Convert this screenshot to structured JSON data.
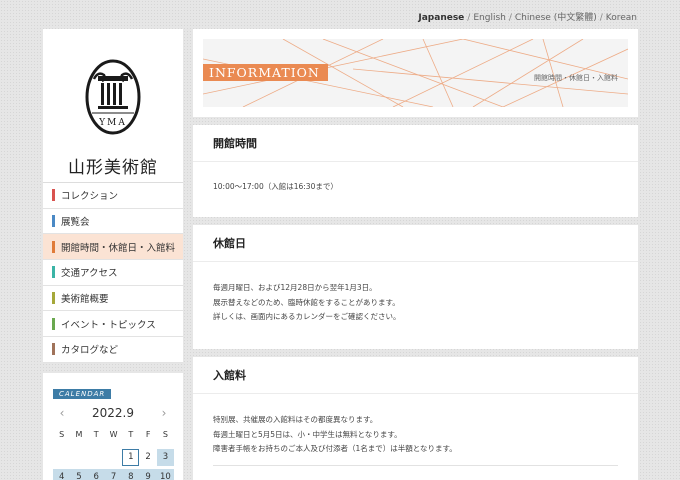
{
  "lang_bar": [
    {
      "label": "Japanese"
    },
    {
      "label": "English"
    },
    {
      "label": "Chinese (中文繁體)"
    },
    {
      "label": "Korean"
    }
  ],
  "logo": {
    "emblem_text": "YMA",
    "name": "山形美術館"
  },
  "nav": [
    {
      "label": "コレクション",
      "color": "#d9534f"
    },
    {
      "label": "展覧会",
      "color": "#4a89c5"
    },
    {
      "label": "開館時間・休館日・入館料",
      "color": "#e07b39"
    },
    {
      "label": "交通アクセス",
      "color": "#3bb4a6"
    },
    {
      "label": "美術館概要",
      "color": "#a5a83a"
    },
    {
      "label": "イベント・トピックス",
      "color": "#6aa84f"
    },
    {
      "label": "カタログなど",
      "color": "#a0735a"
    }
  ],
  "calendar": {
    "badge": "CALENDAR",
    "month": "2022.9",
    "prev_icon": "‹",
    "next_icon": "›",
    "weekdays": [
      "S",
      "M",
      "T",
      "W",
      "T",
      "F",
      "S"
    ],
    "week1": [
      "",
      "",
      "",
      "",
      "1",
      "2",
      "3"
    ],
    "week2": [
      "4",
      "5",
      "6",
      "7",
      "8",
      "9",
      "10"
    ],
    "closed_color": "#c6dce9"
  },
  "banner": {
    "title": "INFORMATION",
    "breadcrumb": "開館時間・休館日・入館料",
    "accent": "#ea8a52"
  },
  "hours": {
    "title": "開館時間",
    "text": "10:00～17:00（入館は16:30まで）"
  },
  "closed": {
    "title": "休館日",
    "lines": [
      "毎週月曜日、および12月28日から翌年1月3日。",
      "展示替えなどのため、臨時休館をすることがあります。",
      "詳しくは、画面内にあるカレンダーをご確認ください。"
    ]
  },
  "admission": {
    "title": "入館料",
    "lines": [
      "特別展、共催展の入館料はその都度異なります。",
      "毎週土曜日と5月5日は、小・中学生は無料となります。",
      "障害者手帳をお持ちのご本人及び付添者（1名まで）は半額となります。"
    ]
  }
}
